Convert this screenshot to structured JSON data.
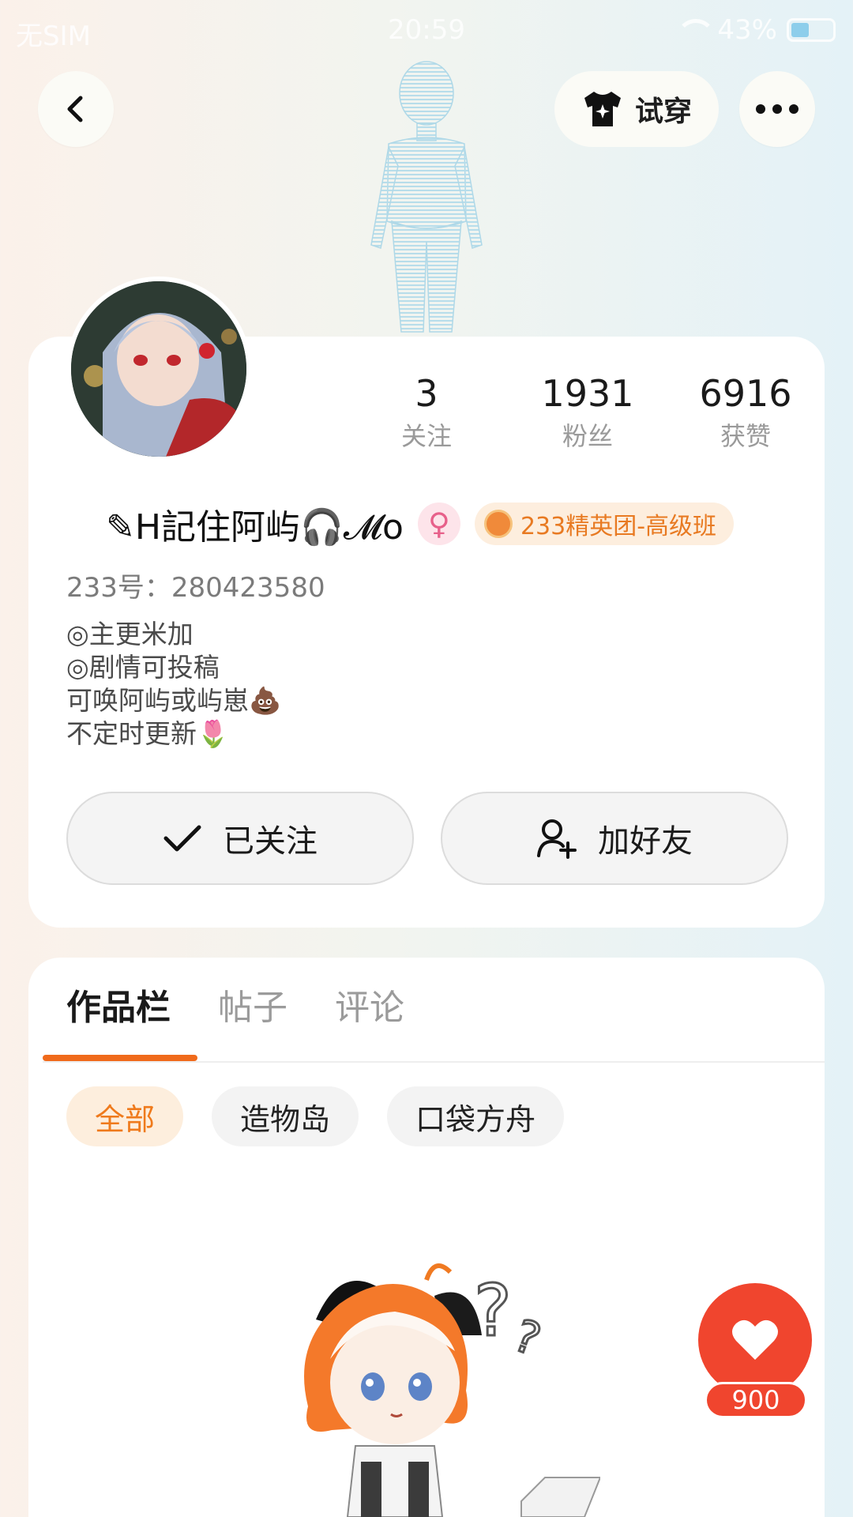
{
  "status_bar": {
    "carrier": "无SIM",
    "time": "20:59",
    "battery": "43%",
    "battery_level": 0.43
  },
  "top_bar": {
    "try_on_label": "试穿"
  },
  "profile": {
    "stats": [
      {
        "value": "3",
        "label": "关注"
      },
      {
        "value": "1931",
        "label": "粉丝"
      },
      {
        "value": "6916",
        "label": "获赞"
      }
    ],
    "name": "✎H記住阿屿🎧𝓜o",
    "gender_symbol": "♀",
    "badge": "233精英团-高级班",
    "user_id": "233号：280423580",
    "bio": [
      "◎主更米加",
      "◎剧情可投稿",
      "可唤阿屿或屿崽💩",
      "不定时更新🌷"
    ],
    "follow_button": "已关注",
    "add_friend_button": "加好友"
  },
  "tabs": [
    {
      "label": "作品栏",
      "active": true
    },
    {
      "label": "帖子",
      "active": false
    },
    {
      "label": "评论",
      "active": false
    }
  ],
  "filters": [
    {
      "label": "全部",
      "active": true
    },
    {
      "label": "造物岛",
      "active": false
    },
    {
      "label": "口袋方舟",
      "active": false
    }
  ],
  "like": {
    "count": "900"
  },
  "colors": {
    "accent": "#f06a1b",
    "like": "#f0452e",
    "badge_text": "#e87a22"
  },
  "icons": [
    "back-arrow-icon",
    "shirt-sparkle-icon",
    "more-dots-icon",
    "checkmark-icon",
    "add-user-icon",
    "heart-icon",
    "wifi-icon",
    "battery-icon"
  ]
}
